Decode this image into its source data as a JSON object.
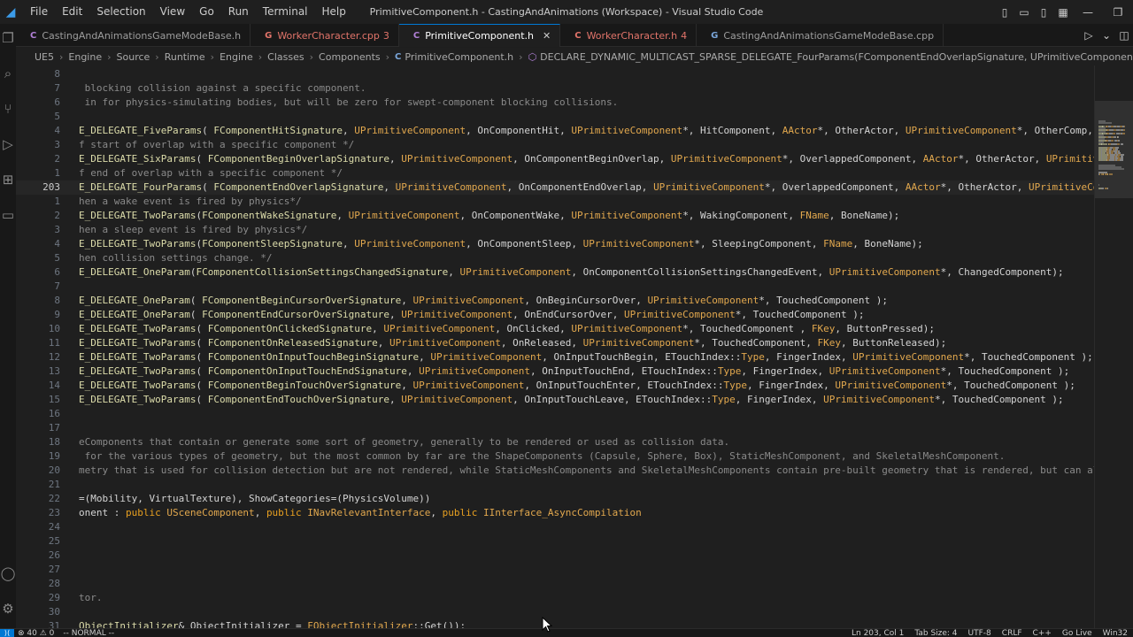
{
  "window": {
    "title": "PrimitiveComponent.h - CastingAndAnimations (Workspace) - Visual Studio Code",
    "menu": [
      "File",
      "Edit",
      "Selection",
      "View",
      "Go",
      "Run",
      "Terminal",
      "Help"
    ]
  },
  "tabs": [
    {
      "name": "CastingAndAnimationsGameModeBase.h",
      "icon": "C",
      "icon_color": "#b180d7",
      "mark": "",
      "modified": false,
      "active": false
    },
    {
      "name": "WorkerCharacter.cpp",
      "icon": "G",
      "icon_color": "#e2746a",
      "mark": "3",
      "modified": true,
      "active": false
    },
    {
      "name": "PrimitiveComponent.h",
      "icon": "C",
      "icon_color": "#b180d7",
      "mark": "",
      "modified": false,
      "active": true
    },
    {
      "name": "WorkerCharacter.h",
      "icon": "C",
      "icon_color": "#e2746a",
      "mark": "4",
      "modified": true,
      "active": false
    },
    {
      "name": "CastingAndAnimationsGameModeBase.cpp",
      "icon": "G",
      "icon_color": "#7aa6da",
      "mark": "",
      "modified": false,
      "active": false
    }
  ],
  "breadcrumb": [
    "UE5",
    "Engine",
    "Source",
    "Runtime",
    "Engine",
    "Classes",
    "Components",
    "PrimitiveComponent.h",
    "DECLARE_DYNAMIC_MULTICAST_SPARSE_DELEGATE_FourParams(FComponentEndOverlapSignature, UPrimitiveComponent, OnComponentEndOverlap, UPrimitiveComponent*, OverlappedComponent, AActor*, OtherActor, UPrimitiveComponent*, OtherComp, int32, OtherBodyIndex)"
  ],
  "colors": {
    "macro": "#dcdcaa",
    "type": "#e2a84e",
    "ident": "#d4d4d4",
    "comment": "#8a8a8a",
    "keyword": "#e8a020",
    "punct": "#d4d4d4"
  },
  "code_lines": [
    {
      "num": "8",
      "tokens": []
    },
    {
      "num": "7",
      "tokens": [
        {
          "t": " blocking collision against a specific component.",
          "c": "comment"
        }
      ]
    },
    {
      "num": "6",
      "tokens": [
        {
          "t": " in for physics-simulating bodies, but will be zero for swept-component blocking collisions.",
          "c": "comment"
        }
      ]
    },
    {
      "num": "5",
      "tokens": []
    },
    {
      "num": "4",
      "tokens": [
        {
          "t": "E_DELEGATE_FiveParams",
          "c": "macro"
        },
        {
          "t": "( ",
          "c": "punct"
        },
        {
          "t": "FComponentHitSignature",
          "c": "macro"
        },
        {
          "t": ", ",
          "c": "punct"
        },
        {
          "t": "UPrimitiveComponent",
          "c": "type"
        },
        {
          "t": ", OnComponentHit, ",
          "c": "ident"
        },
        {
          "t": "UPrimitiveComponent",
          "c": "type"
        },
        {
          "t": "*, HitComponent, ",
          "c": "ident"
        },
        {
          "t": "AActor",
          "c": "type"
        },
        {
          "t": "*, OtherActor, ",
          "c": "ident"
        },
        {
          "t": "UPrimitiveComponent",
          "c": "type"
        },
        {
          "t": "*, OtherComp, ",
          "c": "ident"
        },
        {
          "t": "FVe",
          "c": "type"
        }
      ]
    },
    {
      "num": "3",
      "tokens": [
        {
          "t": "f start of overlap with a specific component */",
          "c": "comment"
        }
      ]
    },
    {
      "num": "2",
      "tokens": [
        {
          "t": "E_DELEGATE_SixParams",
          "c": "macro"
        },
        {
          "t": "( ",
          "c": "punct"
        },
        {
          "t": "FComponentBeginOverlapSignature",
          "c": "macro"
        },
        {
          "t": ", ",
          "c": "punct"
        },
        {
          "t": "UPrimitiveComponent",
          "c": "type"
        },
        {
          "t": ", OnComponentBeginOverlap, ",
          "c": "ident"
        },
        {
          "t": "UPrimitiveComponent",
          "c": "type"
        },
        {
          "t": "*, OverlappedComponent, ",
          "c": "ident"
        },
        {
          "t": "AActor",
          "c": "type"
        },
        {
          "t": "*, OtherActor, ",
          "c": "ident"
        },
        {
          "t": "UPrimitiveCo",
          "c": "type"
        }
      ]
    },
    {
      "num": "1",
      "tokens": [
        {
          "t": "f end of overlap with a specific component */",
          "c": "comment"
        }
      ]
    },
    {
      "num": "203",
      "current": true,
      "tokens": [
        {
          "t": "E_DELEGATE_FourParams",
          "c": "macro"
        },
        {
          "t": "( ",
          "c": "punct"
        },
        {
          "t": "FComponentEndOverlapSignature",
          "c": "macro"
        },
        {
          "t": ", ",
          "c": "punct"
        },
        {
          "t": "UPrimitiveComponent",
          "c": "type"
        },
        {
          "t": ", OnComponentEndOverlap, ",
          "c": "ident"
        },
        {
          "t": "UPrimitiveComponent",
          "c": "type"
        },
        {
          "t": "*, OverlappedComponent, ",
          "c": "ident"
        },
        {
          "t": "AActor",
          "c": "type"
        },
        {
          "t": "*, OtherActor, ",
          "c": "ident"
        },
        {
          "t": "UPrimitiveCompo",
          "c": "type"
        }
      ]
    },
    {
      "num": "1",
      "tokens": [
        {
          "t": "hen a wake event is fired by physics*/",
          "c": "comment"
        }
      ]
    },
    {
      "num": "2",
      "tokens": [
        {
          "t": "E_DELEGATE_TwoParams",
          "c": "macro"
        },
        {
          "t": "(",
          "c": "punct"
        },
        {
          "t": "FComponentWakeSignature",
          "c": "macro"
        },
        {
          "t": ", ",
          "c": "punct"
        },
        {
          "t": "UPrimitiveComponent",
          "c": "type"
        },
        {
          "t": ", OnComponentWake, ",
          "c": "ident"
        },
        {
          "t": "UPrimitiveComponent",
          "c": "type"
        },
        {
          "t": "*, WakingComponent, ",
          "c": "ident"
        },
        {
          "t": "FName",
          "c": "type"
        },
        {
          "t": ", BoneName);",
          "c": "ident"
        }
      ]
    },
    {
      "num": "3",
      "tokens": [
        {
          "t": "hen a sleep event is fired by physics*/",
          "c": "comment"
        }
      ]
    },
    {
      "num": "4",
      "tokens": [
        {
          "t": "E_DELEGATE_TwoParams",
          "c": "macro"
        },
        {
          "t": "(",
          "c": "punct"
        },
        {
          "t": "FComponentSleepSignature",
          "c": "macro"
        },
        {
          "t": ", ",
          "c": "punct"
        },
        {
          "t": "UPrimitiveComponent",
          "c": "type"
        },
        {
          "t": ", OnComponentSleep, ",
          "c": "ident"
        },
        {
          "t": "UPrimitiveComponent",
          "c": "type"
        },
        {
          "t": "*, SleepingComponent, ",
          "c": "ident"
        },
        {
          "t": "FName",
          "c": "type"
        },
        {
          "t": ", BoneName);",
          "c": "ident"
        }
      ]
    },
    {
      "num": "5",
      "tokens": [
        {
          "t": "hen collision settings change. */",
          "c": "comment"
        }
      ]
    },
    {
      "num": "6",
      "tokens": [
        {
          "t": "E_DELEGATE_OneParam",
          "c": "macro"
        },
        {
          "t": "(",
          "c": "punct"
        },
        {
          "t": "FComponentCollisionSettingsChangedSignature",
          "c": "macro"
        },
        {
          "t": ", ",
          "c": "punct"
        },
        {
          "t": "UPrimitiveComponent",
          "c": "type"
        },
        {
          "t": ", OnComponentCollisionSettingsChangedEvent, ",
          "c": "ident"
        },
        {
          "t": "UPrimitiveComponent",
          "c": "type"
        },
        {
          "t": "*, ChangedComponent);",
          "c": "ident"
        }
      ]
    },
    {
      "num": "7",
      "tokens": []
    },
    {
      "num": "8",
      "tokens": [
        {
          "t": "E_DELEGATE_OneParam",
          "c": "macro"
        },
        {
          "t": "( ",
          "c": "punct"
        },
        {
          "t": "FComponentBeginCursorOverSignature",
          "c": "macro"
        },
        {
          "t": ", ",
          "c": "punct"
        },
        {
          "t": "UPrimitiveComponent",
          "c": "type"
        },
        {
          "t": ", OnBeginCursorOver, ",
          "c": "ident"
        },
        {
          "t": "UPrimitiveComponent",
          "c": "type"
        },
        {
          "t": "*, TouchedComponent );",
          "c": "ident"
        }
      ]
    },
    {
      "num": "9",
      "tokens": [
        {
          "t": "E_DELEGATE_OneParam",
          "c": "macro"
        },
        {
          "t": "( ",
          "c": "punct"
        },
        {
          "t": "FComponentEndCursorOverSignature",
          "c": "macro"
        },
        {
          "t": ", ",
          "c": "punct"
        },
        {
          "t": "UPrimitiveComponent",
          "c": "type"
        },
        {
          "t": ", OnEndCursorOver, ",
          "c": "ident"
        },
        {
          "t": "UPrimitiveComponent",
          "c": "type"
        },
        {
          "t": "*, TouchedComponent );",
          "c": "ident"
        }
      ]
    },
    {
      "num": "10",
      "tokens": [
        {
          "t": "E_DELEGATE_TwoParams",
          "c": "macro"
        },
        {
          "t": "( ",
          "c": "punct"
        },
        {
          "t": "FComponentOnClickedSignature",
          "c": "macro"
        },
        {
          "t": ", ",
          "c": "punct"
        },
        {
          "t": "UPrimitiveComponent",
          "c": "type"
        },
        {
          "t": ", OnClicked, ",
          "c": "ident"
        },
        {
          "t": "UPrimitiveComponent",
          "c": "type"
        },
        {
          "t": "*, TouchedComponent , ",
          "c": "ident"
        },
        {
          "t": "FKey",
          "c": "type"
        },
        {
          "t": ", ButtonPressed);",
          "c": "ident"
        }
      ]
    },
    {
      "num": "11",
      "tokens": [
        {
          "t": "E_DELEGATE_TwoParams",
          "c": "macro"
        },
        {
          "t": "( ",
          "c": "punct"
        },
        {
          "t": "FComponentOnReleasedSignature",
          "c": "macro"
        },
        {
          "t": ", ",
          "c": "punct"
        },
        {
          "t": "UPrimitiveComponent",
          "c": "type"
        },
        {
          "t": ", OnReleased, ",
          "c": "ident"
        },
        {
          "t": "UPrimitiveComponent",
          "c": "type"
        },
        {
          "t": "*, TouchedComponent, ",
          "c": "ident"
        },
        {
          "t": "FKey",
          "c": "type"
        },
        {
          "t": ", ButtonReleased);",
          "c": "ident"
        }
      ]
    },
    {
      "num": "12",
      "tokens": [
        {
          "t": "E_DELEGATE_TwoParams",
          "c": "macro"
        },
        {
          "t": "( ",
          "c": "punct"
        },
        {
          "t": "FComponentOnInputTouchBeginSignature",
          "c": "macro"
        },
        {
          "t": ", ",
          "c": "punct"
        },
        {
          "t": "UPrimitiveComponent",
          "c": "type"
        },
        {
          "t": ", OnInputTouchBegin, ETouchIndex::",
          "c": "ident"
        },
        {
          "t": "Type",
          "c": "type"
        },
        {
          "t": ", FingerIndex, ",
          "c": "ident"
        },
        {
          "t": "UPrimitiveComponent",
          "c": "type"
        },
        {
          "t": "*, TouchedComponent );",
          "c": "ident"
        }
      ]
    },
    {
      "num": "13",
      "tokens": [
        {
          "t": "E_DELEGATE_TwoParams",
          "c": "macro"
        },
        {
          "t": "( ",
          "c": "punct"
        },
        {
          "t": "FComponentOnInputTouchEndSignature",
          "c": "macro"
        },
        {
          "t": ", ",
          "c": "punct"
        },
        {
          "t": "UPrimitiveComponent",
          "c": "type"
        },
        {
          "t": ", OnInputTouchEnd, ETouchIndex::",
          "c": "ident"
        },
        {
          "t": "Type",
          "c": "type"
        },
        {
          "t": ", FingerIndex, ",
          "c": "ident"
        },
        {
          "t": "UPrimitiveComponent",
          "c": "type"
        },
        {
          "t": "*, TouchedComponent );",
          "c": "ident"
        }
      ]
    },
    {
      "num": "14",
      "tokens": [
        {
          "t": "E_DELEGATE_TwoParams",
          "c": "macro"
        },
        {
          "t": "( ",
          "c": "punct"
        },
        {
          "t": "FComponentBeginTouchOverSignature",
          "c": "macro"
        },
        {
          "t": ", ",
          "c": "punct"
        },
        {
          "t": "UPrimitiveComponent",
          "c": "type"
        },
        {
          "t": ", OnInputTouchEnter, ETouchIndex::",
          "c": "ident"
        },
        {
          "t": "Type",
          "c": "type"
        },
        {
          "t": ", FingerIndex, ",
          "c": "ident"
        },
        {
          "t": "UPrimitiveComponent",
          "c": "type"
        },
        {
          "t": "*, TouchedComponent );",
          "c": "ident"
        }
      ]
    },
    {
      "num": "15",
      "tokens": [
        {
          "t": "E_DELEGATE_TwoParams",
          "c": "macro"
        },
        {
          "t": "( ",
          "c": "punct"
        },
        {
          "t": "FComponentEndTouchOverSignature",
          "c": "macro"
        },
        {
          "t": ", ",
          "c": "punct"
        },
        {
          "t": "UPrimitiveComponent",
          "c": "type"
        },
        {
          "t": ", OnInputTouchLeave, ETouchIndex::",
          "c": "ident"
        },
        {
          "t": "Type",
          "c": "type"
        },
        {
          "t": ", FingerIndex, ",
          "c": "ident"
        },
        {
          "t": "UPrimitiveComponent",
          "c": "type"
        },
        {
          "t": "*, TouchedComponent );",
          "c": "ident"
        }
      ]
    },
    {
      "num": "16",
      "tokens": []
    },
    {
      "num": "17",
      "tokens": []
    },
    {
      "num": "18",
      "tokens": [
        {
          "t": "eComponents that contain or generate some sort of geometry, generally to be rendered or used as collision data.",
          "c": "comment"
        }
      ]
    },
    {
      "num": "19",
      "tokens": [
        {
          "t": " for the various types of geometry, but the most common by far are the ShapeComponents (Capsule, Sphere, Box), StaticMeshComponent, and SkeletalMeshComponent.",
          "c": "comment"
        }
      ]
    },
    {
      "num": "20",
      "tokens": [
        {
          "t": "metry that is used for collision detection but are not rendered, while StaticMeshComponents and SkeletalMeshComponents contain pre-built geometry that is rendered, but can also",
          "c": "comment"
        }
      ]
    },
    {
      "num": "21",
      "tokens": []
    },
    {
      "num": "22",
      "tokens": [
        {
          "t": "=(Mobility, VirtualTexture), ShowCategories=(PhysicsVolume))",
          "c": "ident"
        }
      ]
    },
    {
      "num": "23",
      "tokens": [
        {
          "t": "onent : ",
          "c": "ident"
        },
        {
          "t": "public ",
          "c": "keyword"
        },
        {
          "t": "USceneComponent",
          "c": "type"
        },
        {
          "t": ", ",
          "c": "ident"
        },
        {
          "t": "public ",
          "c": "keyword"
        },
        {
          "t": "INavRelevantInterface",
          "c": "type"
        },
        {
          "t": ", ",
          "c": "ident"
        },
        {
          "t": "public ",
          "c": "keyword"
        },
        {
          "t": "IInterface_AsyncCompilation",
          "c": "type"
        }
      ]
    },
    {
      "num": "24",
      "tokens": []
    },
    {
      "num": "25",
      "tokens": []
    },
    {
      "num": "26",
      "tokens": []
    },
    {
      "num": "27",
      "tokens": []
    },
    {
      "num": "28",
      "tokens": []
    },
    {
      "num": "29",
      "tokens": [
        {
          "t": "tor.",
          "c": "comment"
        }
      ]
    },
    {
      "num": "30",
      "tokens": []
    },
    {
      "num": "31",
      "tokens": [
        {
          "t": "ObjectInitializer",
          "c": "macro"
        },
        {
          "t": "& ObjectInitializer = ",
          "c": "ident"
        },
        {
          "t": "FObjectInitializer",
          "c": "type"
        },
        {
          "t": "::Get());",
          "c": "ident"
        }
      ]
    }
  ],
  "status": {
    "remote": "",
    "problems": "⊗ 40 ⚠ 0",
    "mode": "-- NORMAL --",
    "position": "Ln 203, Col 1",
    "tab_size": "Tab Size: 4",
    "encoding": "UTF-8",
    "eol": "CRLF",
    "language": "C++",
    "go_live": "Go Live",
    "platform": "Win32"
  }
}
